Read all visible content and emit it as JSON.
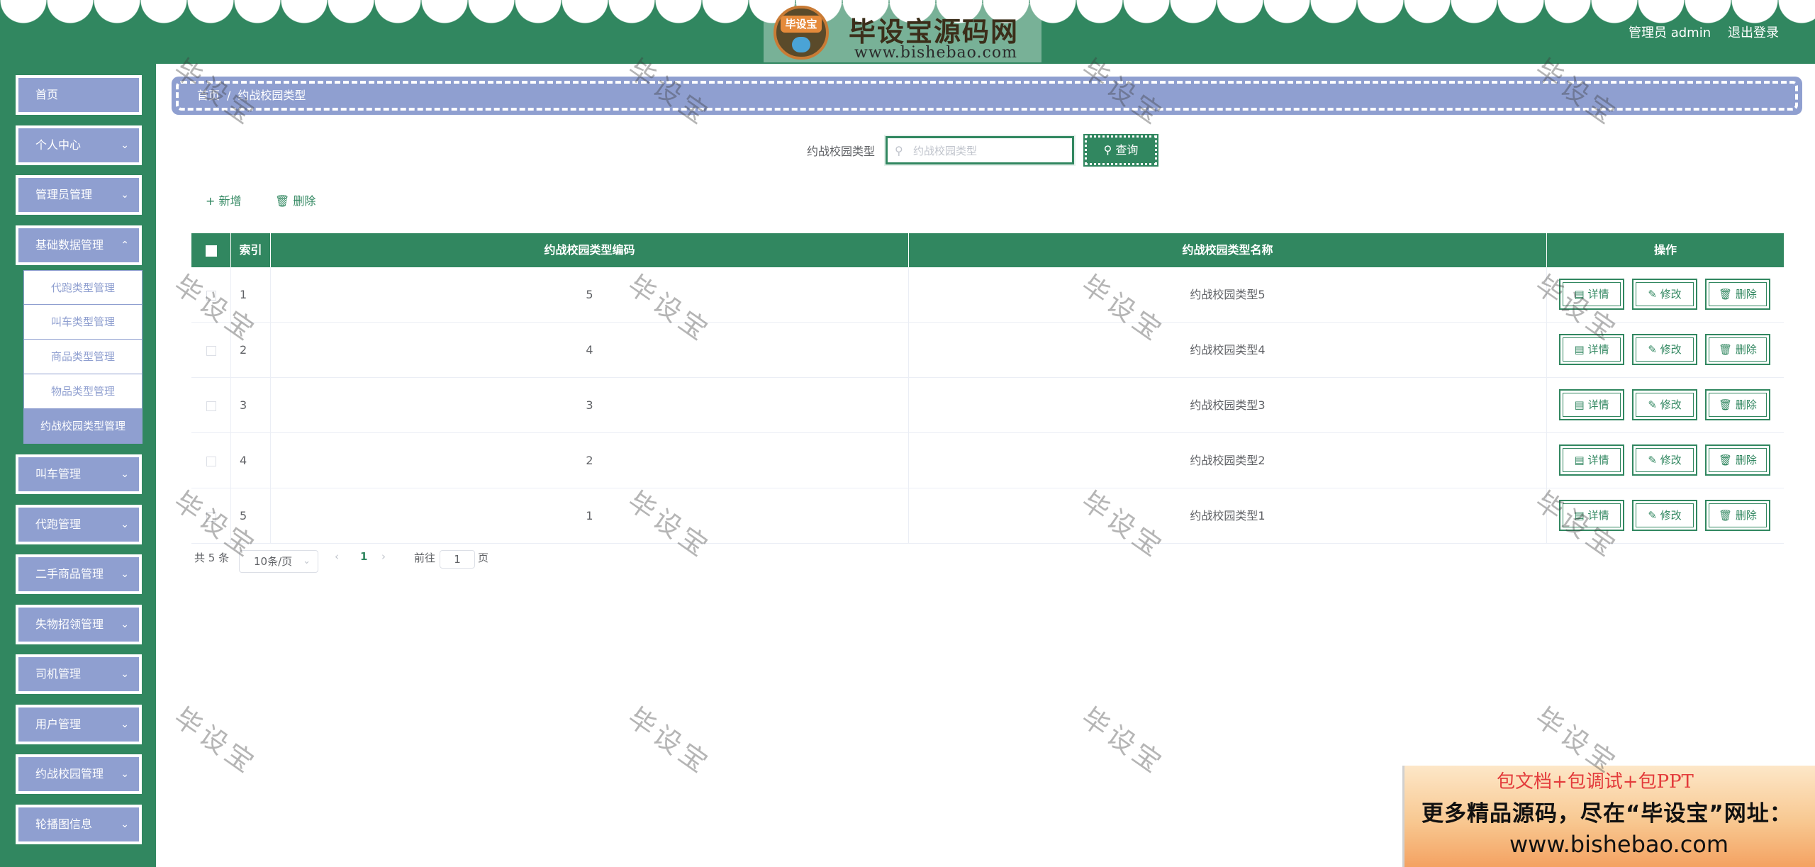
{
  "header": {
    "logo_badge": "毕设宝",
    "logo_title": "毕设宝源码网",
    "logo_url": "www.bishebao.com",
    "admin_name": "管理员 admin",
    "logout_label": "退出登录",
    "accent_color": "#318760"
  },
  "sidebar": {
    "items": [
      {
        "label": "首页"
      },
      {
        "label": "个人中心"
      },
      {
        "label": "管理员管理"
      },
      {
        "label": "基础数据管理"
      },
      {
        "label": "叫车管理"
      },
      {
        "label": "代跑管理"
      },
      {
        "label": "二手商品管理"
      },
      {
        "label": "失物招领管理"
      },
      {
        "label": "司机管理"
      },
      {
        "label": "用户管理"
      },
      {
        "label": "约战校园管理"
      },
      {
        "label": "轮播图信息"
      }
    ],
    "submenu": [
      {
        "label": "代跑类型管理"
      },
      {
        "label": "叫车类型管理"
      },
      {
        "label": "商品类型管理"
      },
      {
        "label": "物品类型管理"
      },
      {
        "label": "约战校园类型管理"
      }
    ],
    "menu_color": "#8f9fd0"
  },
  "breadcrumb": {
    "home": "首页",
    "separator": "/",
    "current": "约战校园类型"
  },
  "search": {
    "label": "约战校园类型",
    "placeholder": "约战校园类型",
    "value": "",
    "button_label": "查询"
  },
  "toolbar": {
    "add_label": "新增",
    "delete_label": "删除"
  },
  "table": {
    "columns": [
      "索引",
      "约战校园类型编码",
      "约战校园类型名称",
      "操作"
    ],
    "rows": [
      {
        "index": "1",
        "code": "5",
        "name": "约战校园类型5"
      },
      {
        "index": "2",
        "code": "4",
        "name": "约战校园类型4"
      },
      {
        "index": "3",
        "code": "3",
        "name": "约战校园类型3"
      },
      {
        "index": "4",
        "code": "2",
        "name": "约战校园类型2"
      },
      {
        "index": "5",
        "code": "1",
        "name": "约战校园类型1"
      }
    ],
    "actions": {
      "detail": "详情",
      "edit": "修改",
      "delete": "删除"
    }
  },
  "pagination": {
    "total": "共 5 条",
    "page_size": "10条/页",
    "current_page": "1",
    "goto_prefix": "前往",
    "goto_value": "1",
    "goto_suffix": "页"
  },
  "watermark": "毕设宝",
  "promo": {
    "line1": "包文档+包调试+包PPT",
    "line2": "更多精品源码，尽在“毕设宝”网址：",
    "line3": "www.bishebao.com"
  }
}
